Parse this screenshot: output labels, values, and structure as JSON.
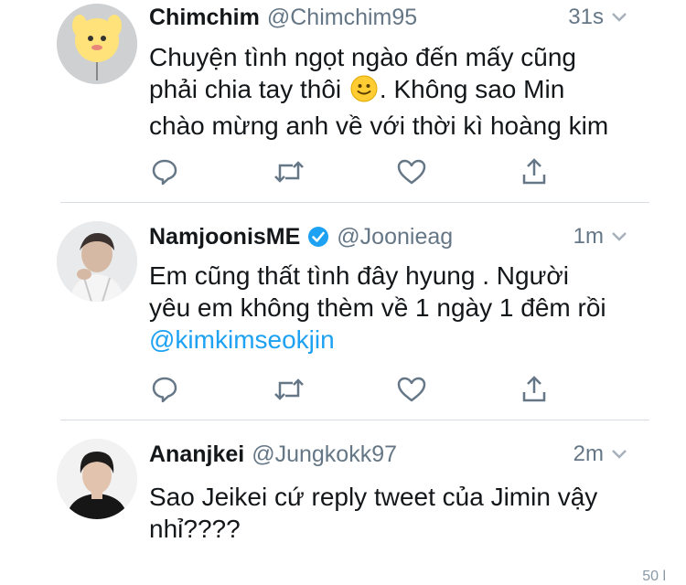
{
  "tweets": [
    {
      "name": "Chimchim",
      "handle": "@Chimchim95",
      "time": "31s",
      "verified": false,
      "text_line1": "Chuyện tình ngọt ngào đến mấy cũng",
      "text_line2_a": "phải chia tay thôi",
      "text_line2_b": ". Không sao Min",
      "text_line3": "chào mừng anh về với thời kì hoàng kim",
      "emoji": "slightly-smiling-face-emoji"
    },
    {
      "name": "NamjoonisME",
      "handle": "@Joonieag",
      "time": "1m",
      "verified": true,
      "text_line1": "Em cũng thất tình đây hyung . Người",
      "text_line2": "yêu em không thèm về 1 ngày 1 đêm rồi",
      "mention": "@kimkimseokjin"
    },
    {
      "name": "Ananjkei",
      "handle": "@Jungkokk97",
      "time": "2m",
      "verified": false,
      "text_line1": "Sao Jeikei cứ reply tweet của Jimin vậy",
      "text_line2": "nhỉ????"
    }
  ],
  "icons": {
    "reply": "reply-icon",
    "retweet": "retweet-icon",
    "like": "like-icon",
    "share": "share-icon",
    "chevron": "chevron-down-icon",
    "verified": "verified-badge-icon"
  },
  "colors": {
    "text": "#14171a",
    "secondary": "#657786",
    "link": "#1da1f2",
    "divider": "#d7dde2",
    "icon": "#657786"
  },
  "footer_count": "50 l"
}
